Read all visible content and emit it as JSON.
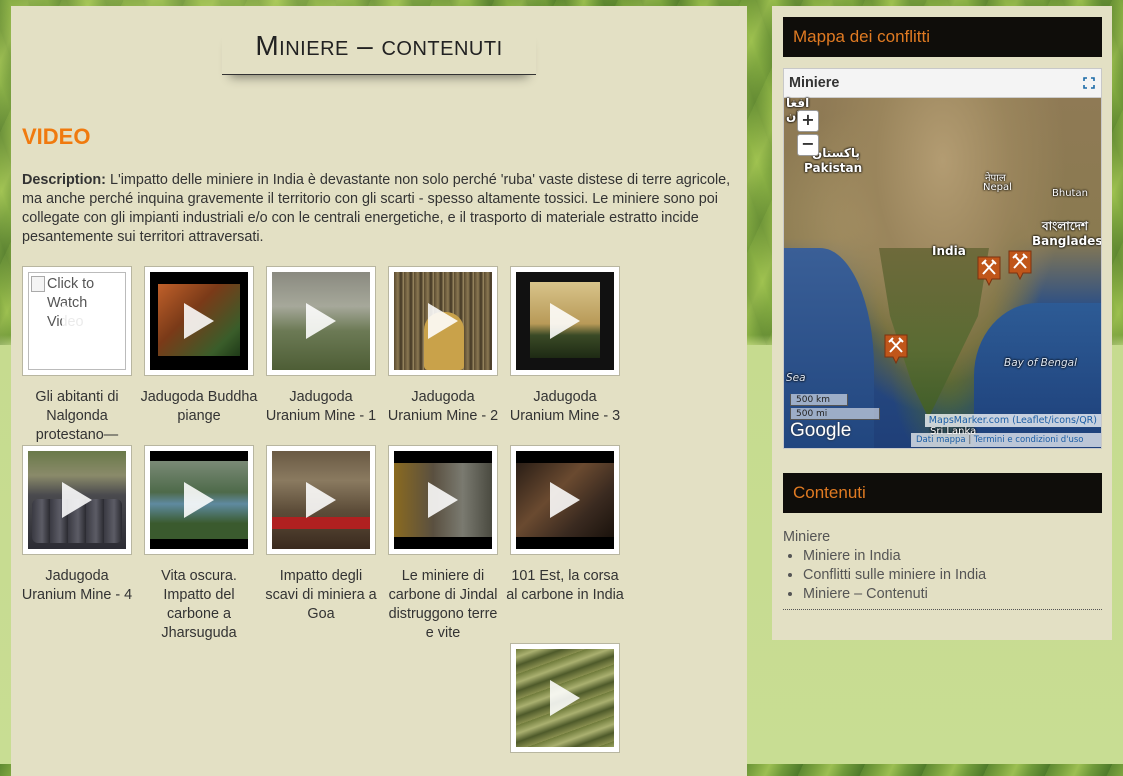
{
  "page": {
    "title": "Miniere – contenuti",
    "section_heading": "VIDEO",
    "description_label": "Description:",
    "description_text": "L'impatto delle miniere in India è devastante non solo perché 'ruba' vaste distese di terre agricole, ma anche perché inquina gravemente il territorio con gli scarti - spesso altamente tossici. Le miniere sono poi collegate con gli impianti industriali e/o con le centrali energetiche, e il trasporto di materiale estratto incide pesantemente sui territori attraversati."
  },
  "videos": [
    {
      "caption": "Gli abitanti di Nalgonda protestano—",
      "broken_alt": "Click to Watch Video"
    },
    {
      "caption": "Jadugoda Buddha piange"
    },
    {
      "caption": "Jadugoda Uranium Mine - 1"
    },
    {
      "caption": "Jadugoda Uranium Mine - 2"
    },
    {
      "caption": "Jadugoda Uranium Mine - 3"
    },
    {
      "caption": "Jadugoda Uranium Mine - 4"
    },
    {
      "caption": "Vita oscura. Impatto del carbone a Jharsuguda"
    },
    {
      "caption": "Impatto degli scavi di miniera a Goa"
    },
    {
      "caption": "Le miniere di carbone di Jindal distruggono terre e vite"
    },
    {
      "caption": "101 Est, la corsa al carbone in India"
    },
    {
      "caption": ""
    }
  ],
  "sidebar": {
    "map_widget_title": "Mappa dei conflitti",
    "map": {
      "layer_name": "Miniere",
      "zoom_in": "+",
      "zoom_out": "−",
      "labels": {
        "afghanistan_native": "افغا",
        "afghanistan_native2": "ستان",
        "pakistan_native": "پاکستان",
        "pakistan": "Pakistan",
        "nepal_native": "नेपाल",
        "nepal": "Nepal",
        "bhutan": "Bhutan",
        "bangladesh_native": "বাংলাদেশ",
        "bangladesh": "Bangladesh",
        "india": "India",
        "bay_of_bengal": "Bay of Bengal",
        "sea": "Sea",
        "sri_lanka": "Sri Lanka"
      },
      "scale_km": "500 km",
      "scale_mi": "500 mi",
      "google": "Google",
      "attribution_link": "MapsMarker.com",
      "attribution_extra": "(Leaflet/icons/QR)",
      "terms_left": "Dati mappa",
      "terms_right": "Termini e condizioni d'uso",
      "marker_count": 3
    },
    "contents_title": "Contenuti",
    "contents_parent": "Miniere",
    "contents_items": [
      "Miniere in India",
      "Conflitti sulle miniere in India",
      "Miniere – Contenuti"
    ]
  },
  "colors": {
    "accent_orange": "#f07a0e",
    "panel_bg": "#e3e0c4",
    "widget_head_bg": "#0f0d0a",
    "widget_head_text": "#e07a22"
  }
}
